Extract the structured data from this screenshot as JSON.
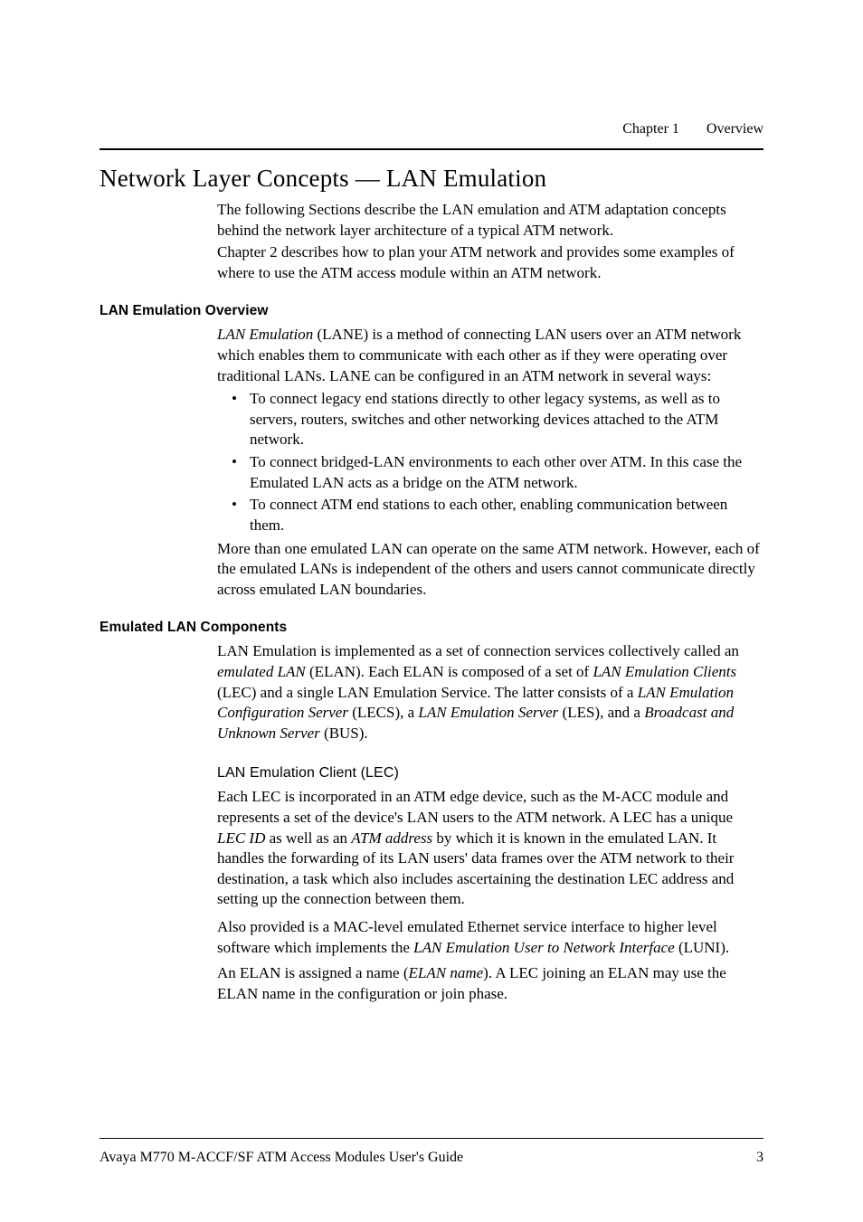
{
  "header": {
    "chapter_label": "Chapter 1",
    "chapter_title": "Overview"
  },
  "title": "Network Layer Concepts — LAN Emulation",
  "intro_p1": "The following Sections describe the LAN emulation and ATM adaptation concepts behind the network layer architecture of a typical ATM network.",
  "intro_p2": "Chapter 2 describes how to plan your ATM network and provides some examples of where to use the ATM access module within an ATM network.",
  "sec1": {
    "heading": "LAN Emulation Overview",
    "p1_pre": "LAN Emulation",
    "p1_post": " (LANE) is a method of connecting LAN users over an ATM network which enables them to communicate with each other as if they were operating over traditional LANs. LANE can be configured in an ATM network in several ways:",
    "bullets": [
      "To connect legacy end stations directly to other legacy systems, as well as to servers, routers, switches and other networking devices attached to the ATM network.",
      "To connect bridged-LAN environments to each other over ATM. In this case the Emulated LAN acts as a bridge on the ATM network.",
      "To connect ATM end stations to each other, enabling communication between them."
    ],
    "p2": "More than one emulated LAN can operate on the same ATM network. However, each of the emulated LANs is independent of the others and users cannot communicate directly across emulated LAN boundaries."
  },
  "sec2": {
    "heading": "Emulated LAN Components",
    "p1_a": "LAN Emulation is implemented as a set of connection services collectively called an ",
    "p1_i1": "emulated LAN",
    "p1_b": " (ELAN). Each ELAN is composed of a set of ",
    "p1_i2": "LAN Emulation Clients",
    "p1_c": " (LEC) and a single LAN Emulation Service. The latter consists of a ",
    "p1_i3": "LAN Emulation Configuration Server",
    "p1_d": " (LECS), a ",
    "p1_i4": "LAN Emulation Server",
    "p1_e": " (LES), and a ",
    "p1_i5": "Broadcast and Unknown Server",
    "p1_f": " (BUS).",
    "sub_heading": "LAN Emulation Client (LEC)",
    "p2_a": "Each LEC is incorporated in an ATM edge device, such as the M-ACC module and represents a set of the device's LAN users to the ATM network. A LEC has a unique ",
    "p2_i1": "LEC ID",
    "p2_b": " as well as an ",
    "p2_i2": "ATM address",
    "p2_c": " by which it is known in the emulated LAN. It handles the forwarding of its LAN users' data frames over the ATM network to their destination, a task which also includes ascertaining the destination LEC address and setting up the connection between them.",
    "p3_a": "Also provided is a MAC-level emulated Ethernet service interface to higher level software which implements the ",
    "p3_i1": "LAN Emulation User to Network Interface",
    "p3_b": " (LUNI).",
    "p4_a": "An ELAN is assigned a name (",
    "p4_i1": "ELAN name",
    "p4_b": "). A LEC joining an ELAN may use the ELAN name in the configuration or join phase."
  },
  "footer": {
    "left": "Avaya M770 M-ACCF/SF ATM Access Modules User's Guide",
    "right": "3"
  }
}
